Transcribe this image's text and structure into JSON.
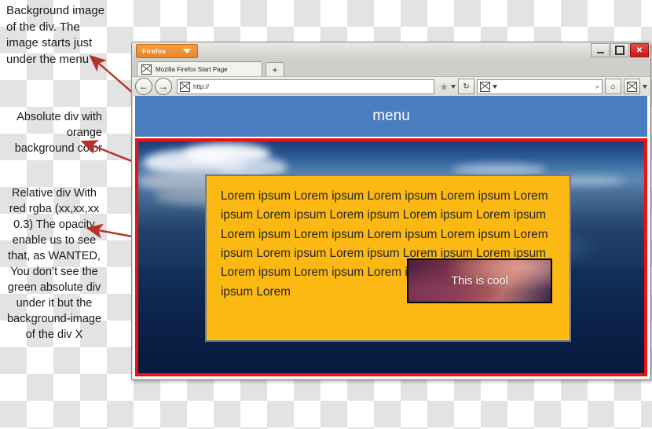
{
  "annotations": [
    {
      "id": "a0",
      "text": "Background image of the div. The image starts just under the menu"
    },
    {
      "id": "a1",
      "text": "Absolute div with orange background color"
    },
    {
      "id": "a2",
      "text": "Relative div With red rgba (xx,xx,xx 0.3) The opacity enable us to see that, as WANTED, You don’t see the green absolute div under it but the background-image of the div X"
    }
  ],
  "browser": {
    "firefox_button_label": "Firefox",
    "window_controls": {
      "minimize": "—",
      "maximize": "□",
      "close": "✕"
    },
    "tab": {
      "label": "Mozilla Firefox Start Page",
      "favicon": "broken-image-icon"
    },
    "new_tab_label": "+",
    "nav": {
      "back": "←",
      "forward": "→"
    },
    "url_value": "http://",
    "search_value": "",
    "search_magnifier": "⌕",
    "bookmark_star": "★",
    "reload": "↻",
    "home": "⌂"
  },
  "page": {
    "menu_label": "menu",
    "lorem_text": "Lorem ipsum Lorem ipsum Lorem ipsum Lorem ipsum Lorem ipsum Lorem ipsum Lorem ipsum Lorem ipsum Lorem ipsum Lorem ipsum Lorem ipsum Lorem ipsum Lorem ipsum Lorem ipsum Lorem ipsum Lorem ipsum Lorem ipsum Lorem ipsum Lorem ipsum Lorem ipsum Lorem ipsum Lorem ipsum Lorem ipsum Lorem",
    "cool_caption": "This is cool"
  },
  "colors": {
    "orange_div": "#fcb813",
    "red_border": "#f20f0f",
    "menu_blue": "#4a7ec0",
    "firefox_orange": "#e8862a",
    "close_red": "#c01b1b",
    "arrow_red": "#b5332a"
  }
}
